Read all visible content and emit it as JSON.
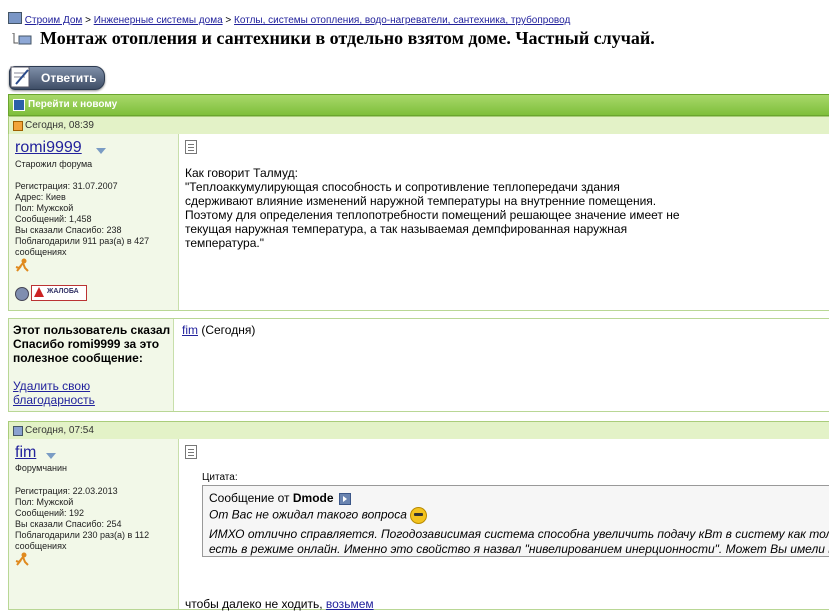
{
  "breadcrumb": {
    "items": [
      "Строим Дом",
      "Инженерные системы дома",
      "Котлы, системы отопления, водо-нагреватели, сантехника, трубопровод"
    ],
    "separator": ">"
  },
  "thread": {
    "title": "Монтаж отопления и сантехники в отдельно взятом доме. Частный случай."
  },
  "toolbar": {
    "reply_label": "Ответить"
  },
  "navbar": {
    "label": "Перейти к новому"
  },
  "posts": [
    {
      "date": "Сегодня, 08:39",
      "user": {
        "name": "romi9999",
        "rank": "Старожил форума",
        "info": [
          "Регистрация: 31.07.2007",
          "Адрес: Киев",
          "Пол: Мужской",
          "Сообщений: 1,458",
          "Вы сказали Спасибо: 238",
          "Поблагодарили 911 раз(а) в 427 сообщениях"
        ]
      },
      "report_label": "ЖАЛОБА",
      "message": [
        "Как говорит Талмуд:",
        "\"Теплоаккумулирующая способность и сопротивление теплопередачи здания",
        "сдерживают влияние изменений наружной температуры на внутренние помещения.",
        "Поэтому для определения теплопотребности помещений решающее значение имеет не",
        "текущая наружная температура, а так называемая демпфированная наружная",
        "температура.\""
      ]
    },
    {
      "date": "Сегодня, 07:54",
      "user": {
        "name": "fim",
        "rank": "Форумчанин",
        "info": [
          "Регистрация: 22.03.2013",
          "Пол: Мужской",
          "Сообщений: 192",
          "Вы сказали Спасибо: 254",
          "Поблагодарили 230 раз(а) в 112 сообщениях"
        ]
      },
      "quote": {
        "label": "Цитата:",
        "from_prefix": "Сообщение от",
        "from_user": "Dmode",
        "line1": "От Вас не ожидал такого вопроса",
        "line2": "ИМХО отлично справляется. Погодозависимая система способна увеличить подачу кВт в систему как только",
        "line3": "есть в режиме онлайн. Именно это свойство я назвал \"нивелированием инерционности\". Может Вы имели в в"
      },
      "after_text": "чтобы далеко не ходить,",
      "after_link": "возьмем"
    }
  ],
  "thanks": {
    "title": "Этот пользователь сказал Спасибо romi9999 за это полезное сообщение:",
    "remove_label": "Удалить свою благодарность",
    "user": "fim",
    "when": "(Сегодня)"
  },
  "colors": {
    "accent_green": "#7fbf3b",
    "link": "#22229c",
    "header_bg": "#e3f2c7"
  }
}
